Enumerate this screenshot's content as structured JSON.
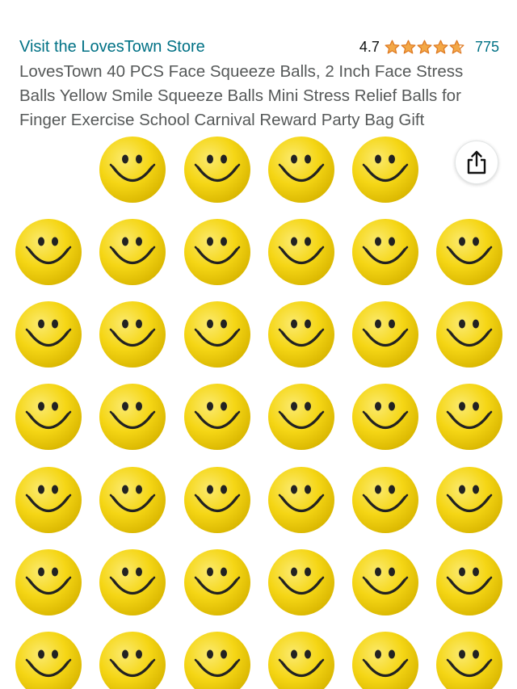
{
  "store": {
    "link_text": "Visit the LovesTown Store"
  },
  "rating": {
    "value": "4.7",
    "count": "775",
    "stars": 4.7,
    "star_color": "#f3a847"
  },
  "product": {
    "title": "LovesTown 40 PCS Face Squeeze Balls, 2 Inch Face Stress Balls Yellow Smile Squeeze Balls Mini Stress Relief Balls for Finger Exercise School Carnival Reward Party Bag Gift"
  },
  "image": {
    "subject": "smiley-face-ball",
    "ball_color": "#f5d615",
    "face_color": "#222222"
  },
  "share": {
    "icon": "share-icon"
  }
}
